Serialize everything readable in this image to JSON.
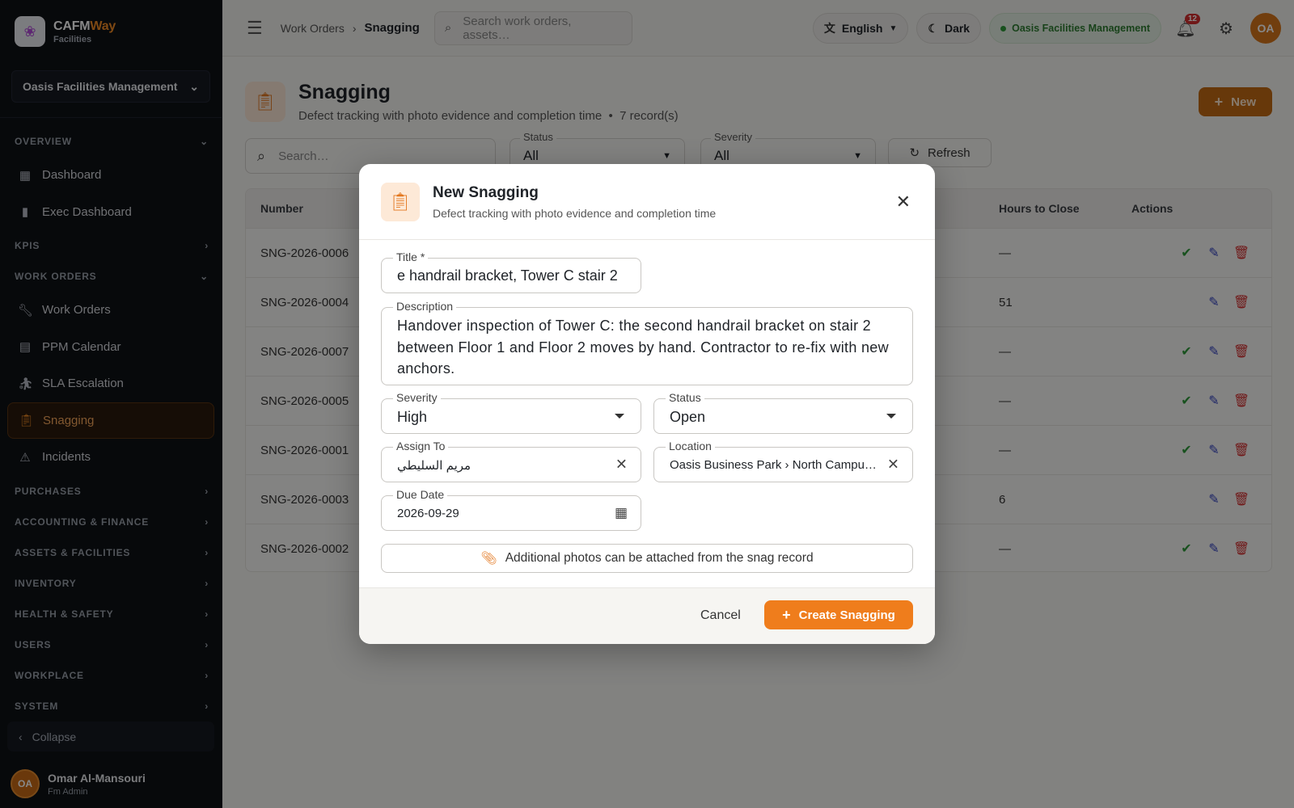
{
  "sidebar": {
    "brand": {
      "name_a": "CAFM",
      "name_b": "Way",
      "sub": "Facilities"
    },
    "org": "Oasis Facilities Management",
    "sections": [
      {
        "title": "OVERVIEW",
        "items": [
          "Dashboard",
          "Exec Dashboard"
        ]
      },
      {
        "title": "KPIS"
      },
      {
        "title": "WORK ORDERS",
        "items": [
          "Work Orders",
          "PPM Calendar",
          "SLA Escalation",
          "Snagging",
          "Incidents"
        ]
      },
      {
        "title": "PURCHASES"
      },
      {
        "title": "ACCOUNTING & FINANCE"
      },
      {
        "title": "ASSETS & FACILITIES"
      },
      {
        "title": "INVENTORY"
      },
      {
        "title": "HEALTH & SAFETY"
      },
      {
        "title": "USERS"
      },
      {
        "title": "WORKPLACE"
      },
      {
        "title": "SYSTEM"
      }
    ],
    "collapse": "Collapse",
    "user": {
      "initials": "OA",
      "name": "Omar Al-Mansouri",
      "role": "Fm Admin"
    }
  },
  "topbar": {
    "breadcrumb": [
      "Work Orders",
      "Snagging"
    ],
    "search_placeholder": "Search work orders, assets…",
    "language": "English",
    "theme": "Dark",
    "org": "Oasis Facilities Management",
    "notifications": "12",
    "avatar": "OA"
  },
  "page": {
    "title": "Snagging",
    "subtitle": "Defect tracking with photo evidence and completion time",
    "records": "7 record(s)",
    "new_label": "New"
  },
  "filters": {
    "search_placeholder": "Search…",
    "status_label": "Status",
    "status_value": "All",
    "severity_label": "Severity",
    "severity_value": "All",
    "refresh": "Refresh"
  },
  "table": {
    "headers": {
      "number": "Number",
      "hours": "Hours to Close",
      "actions": "Actions"
    },
    "rows": [
      {
        "number": "SNG-2026-0006",
        "hours": "—",
        "complete": true
      },
      {
        "number": "SNG-2026-0004",
        "hours": "51",
        "complete": false
      },
      {
        "number": "SNG-2026-0007",
        "hours": "—",
        "complete": true
      },
      {
        "number": "SNG-2026-0005",
        "hours": "—",
        "complete": true
      },
      {
        "number": "SNG-2026-0001",
        "hours": "—",
        "complete": true
      },
      {
        "number": "SNG-2026-0003",
        "hours": "6",
        "complete": false
      },
      {
        "number": "SNG-2026-0002",
        "hours": "—",
        "complete": true
      }
    ]
  },
  "modal": {
    "title": "New Snagging",
    "subtitle": "Defect tracking with photo evidence and completion time",
    "title_label": "Title *",
    "title_value": "e handrail bracket, Tower C stair 2",
    "description_label": "Description",
    "description_value": "Handover inspection of Tower C: the second handrail bracket on stair 2 between Floor 1 and Floor 2 moves by hand. Contractor to re-fix with new anchors.",
    "severity_label": "Severity",
    "severity_value": "High",
    "status_label": "Status",
    "status_value": "Open",
    "assign_label": "Assign To",
    "assign_value": "مريم السليطي",
    "location_label": "Location",
    "location_value": "Oasis Business Park › North Campu…",
    "due_label": "Due Date",
    "due_value": "2026-09-29",
    "attach_note": "Additional photos can be attached from the snag record",
    "cancel": "Cancel",
    "create": "Create Snagging"
  }
}
